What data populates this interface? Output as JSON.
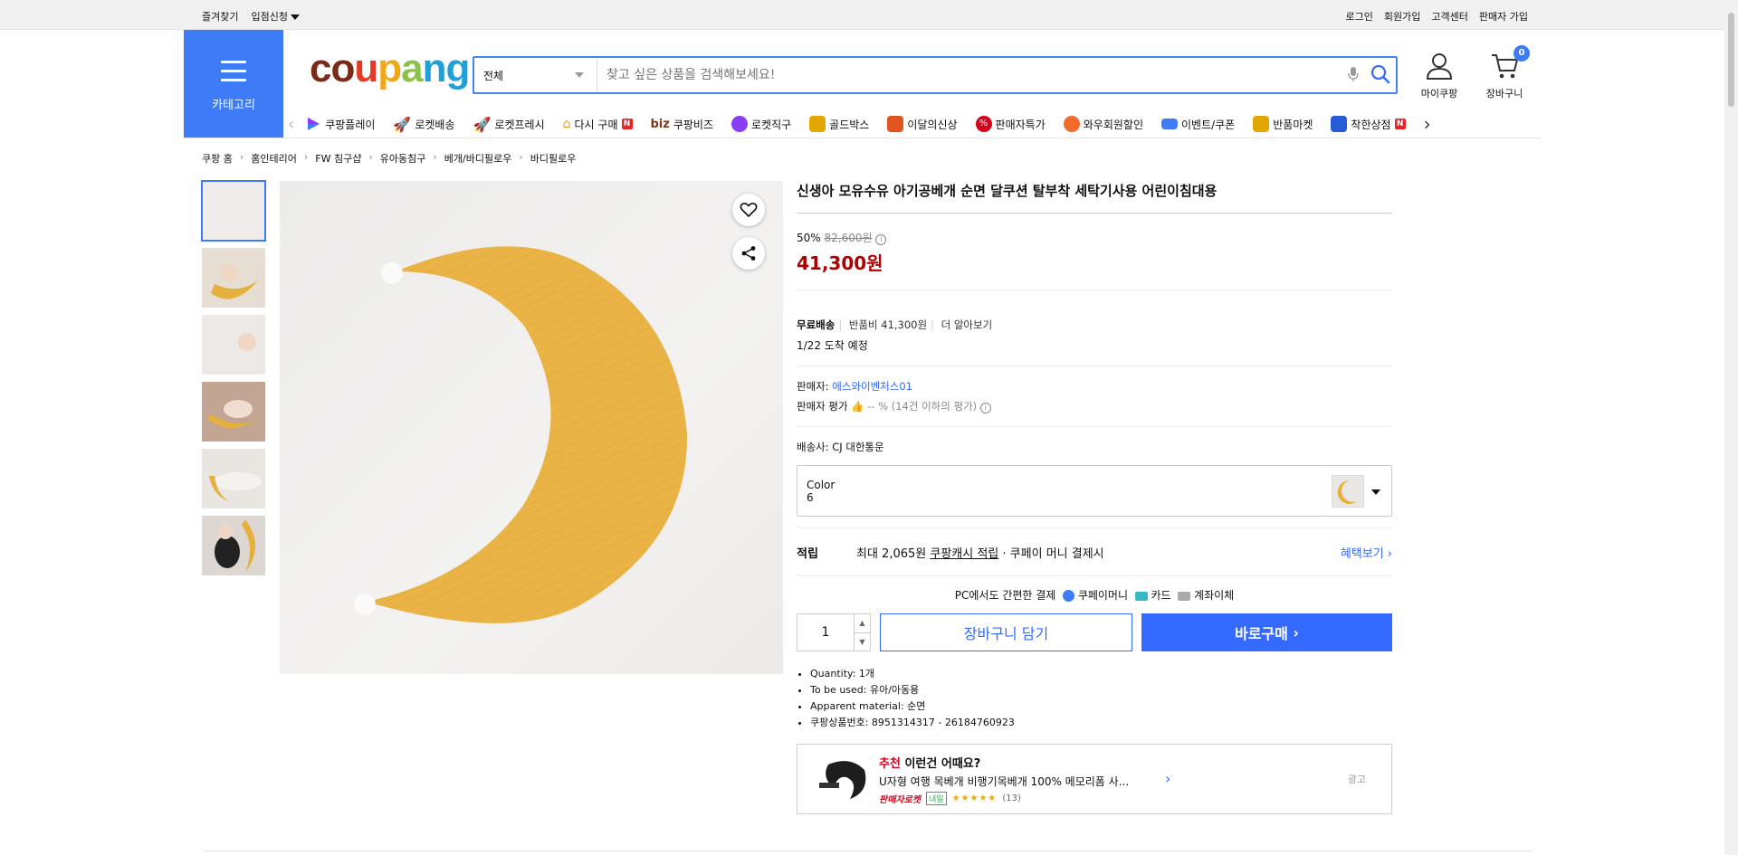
{
  "topbar": {
    "favorites": "즐겨찾기",
    "partner_apply": "입점신청",
    "links": [
      "로그인",
      "회원가입",
      "고객센터",
      "판매자 가입"
    ]
  },
  "header": {
    "category_label": "카테고리",
    "logo": "coupang",
    "search_category": "전체",
    "search_placeholder": "찾고 싶은 상품을 검색해보세요!",
    "mypage_label": "마이쿠팡",
    "cart_label": "장바구니",
    "cart_count": "0"
  },
  "nav": {
    "items": [
      {
        "label": "쿠팡플레이",
        "color": "#3d7bf7"
      },
      {
        "label": "로켓배송",
        "color": "#3d7bf7"
      },
      {
        "label": "로켓프레시",
        "color": "#2ab04a"
      },
      {
        "label": "다시 구매",
        "color": "#f39c12"
      },
      {
        "label": "쿠팡비즈",
        "prefix": "biz",
        "color": "#7a3b1c"
      },
      {
        "label": "로켓직구",
        "color": "#8a3df7"
      },
      {
        "label": "골드박스",
        "color": "#e2a700"
      },
      {
        "label": "이달의신상",
        "color": "#e2541f"
      },
      {
        "label": "판매자특가",
        "color": "#d6001c"
      },
      {
        "label": "와우회원할인",
        "color": "#f26b2a"
      },
      {
        "label": "이벤트/쿠폰",
        "color": "#3d7bf7"
      },
      {
        "label": "반품마켓",
        "color": "#e2a700"
      },
      {
        "label": "착한상점",
        "color": "#2a5bd7"
      }
    ]
  },
  "breadcrumb": [
    "쿠팡 홈",
    "홈인테리어",
    "FW 침구샵",
    "유아동침구",
    "베개/바디필로우",
    "바디필로우"
  ],
  "product": {
    "title": "신생아 모유수유 아기공베개 순면 달쿠션 탈부착 세탁기사용 어린이침대용",
    "discount": "50%",
    "original_price": "82,600원",
    "price": "41,300원",
    "free_shipping": "무료배송",
    "return_fee": "반품비 41,300원",
    "more": "더 알아보기",
    "arrival": "1/22 도착 예정",
    "seller_label": "판매자:",
    "seller_name": "에스와이벤처스01",
    "seller_rating_label": "판매자 평가",
    "seller_rating_value": "-- %",
    "seller_rating_note": "(14건 이하의 평가)",
    "carrier_label": "배송사:",
    "carrier": "CJ 대한통운",
    "option_label": "Color",
    "option_value": "6",
    "reward_label": "적립",
    "reward_text_1": "최대 2,065원",
    "reward_link": "쿠팡캐시 적립",
    "reward_text_2": "· 쿠페이 머니 결제시",
    "reward_more": "혜택보기",
    "pay_title": "PC에서도 간편한 결제",
    "pay_methods": [
      "쿠페이머니",
      "카드",
      "계좌이체"
    ],
    "quantity": "1",
    "add_cart": "장바구니 담기",
    "buy_now": "바로구매",
    "attributes": [
      "Quantity: 1개",
      "To be used: 유아/아동용",
      "Apparent material: 순면",
      "쿠팡상품번호: 8951314317 - 26184760923"
    ]
  },
  "recommend": {
    "title_highlight": "추천",
    "title_rest": " 이런건 어때요?",
    "name": "U자형 여행 목베개 비행기목베개 100% 메모리폼 사...",
    "seller_badge": "판매자로켓",
    "tomorrow": "내일",
    "rating": 5,
    "reviews": "(13)",
    "ad": "광고"
  }
}
